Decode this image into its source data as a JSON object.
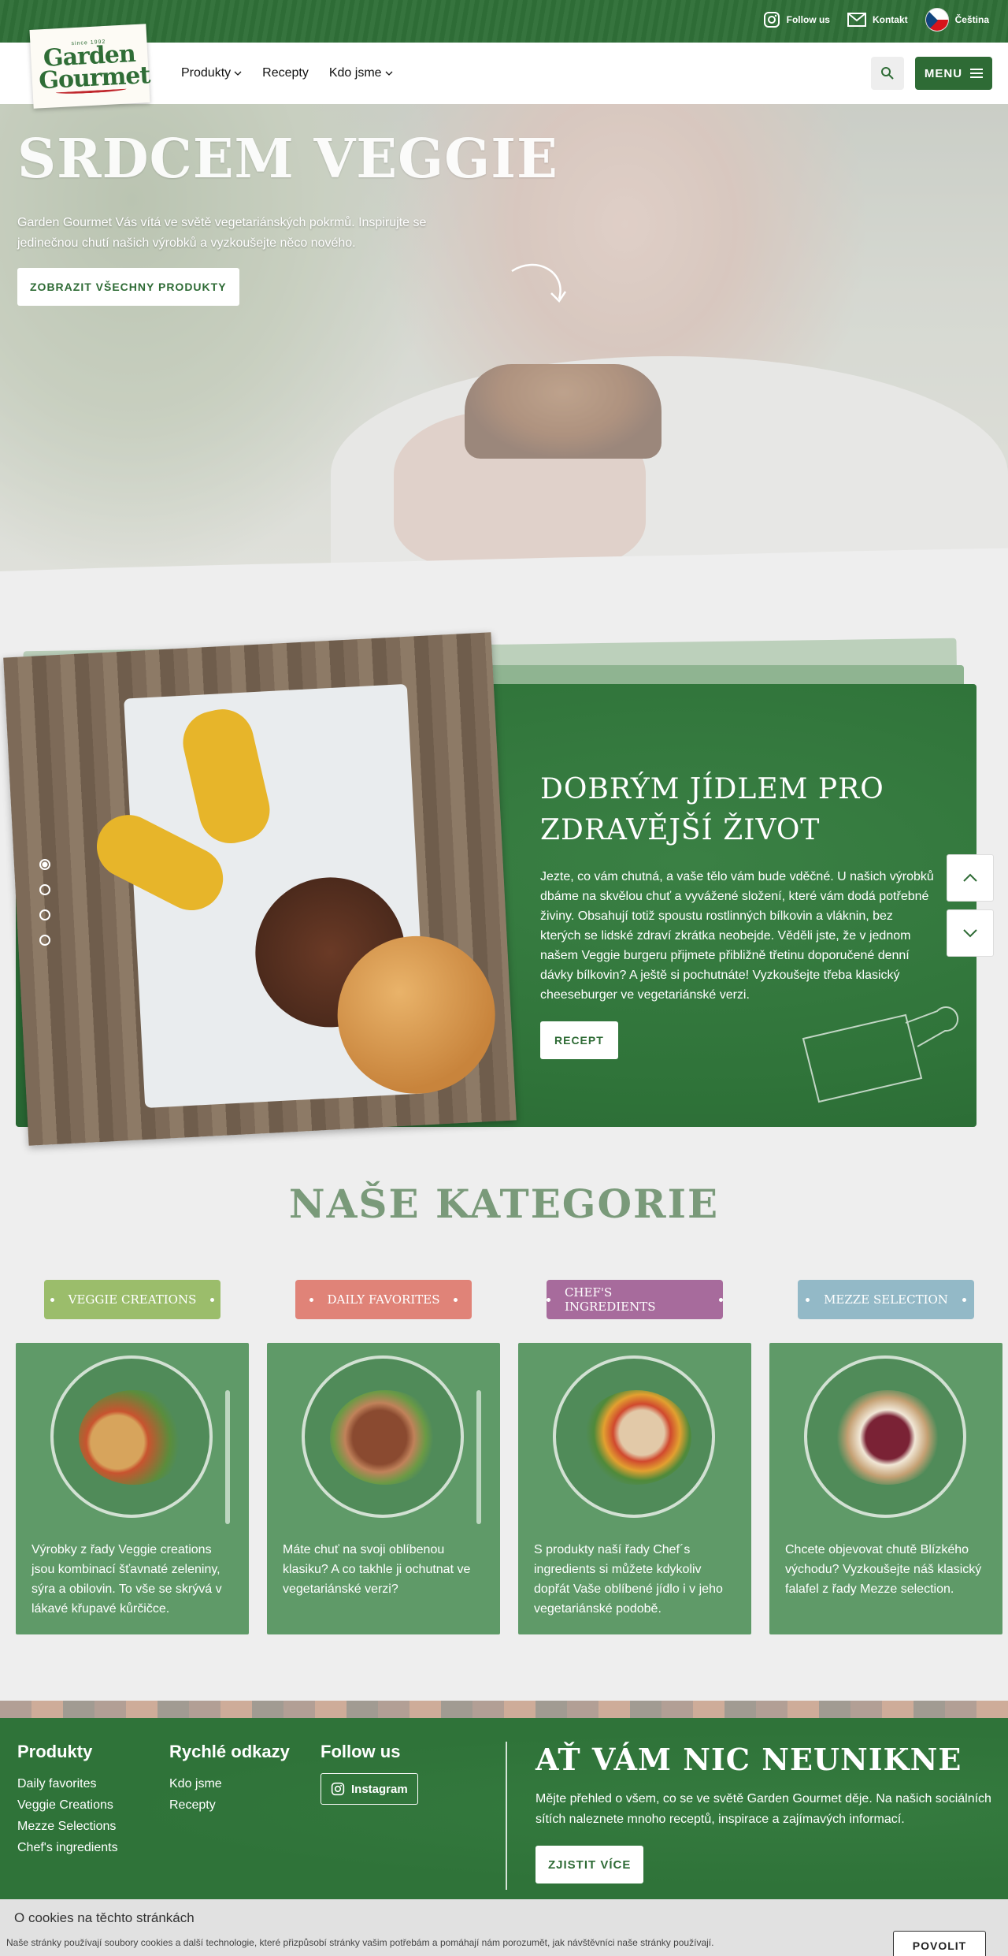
{
  "topbar": {
    "follow_us": "Follow us",
    "contact": "Kontakt",
    "language": "Čeština"
  },
  "header": {
    "logo_since": "since 1992",
    "logo_line1": "Garden",
    "logo_line2": "Gourmet",
    "nav": [
      {
        "label": "Produkty",
        "dropdown": true
      },
      {
        "label": "Recepty",
        "dropdown": false
      },
      {
        "label": "Kdo jsme",
        "dropdown": true
      }
    ],
    "menu_label": "MENU"
  },
  "hero": {
    "title": "SRDCEM VEGGIE",
    "subtitle": "Garden Gourmet Vás vítá ve světě vegetariánských pokrmů. Inspirujte se jedinečnou chutí našich výrobků a vyzkoušejte něco nového.",
    "cta": "ZOBRAZIT VŠECHNY PRODUKTY"
  },
  "slider": {
    "title": "DOBRÝM JÍDLEM PRO ZDRAVĚJŠÍ ŽIVOT",
    "text": "Jezte, co vám chutná, a vaše tělo vám bude vděčné. U našich výrobků dbáme na skvělou chuť a vyvážené složení, které vám dodá potřebné živiny. Obsahují totiž spoustu rostlinných bílkovin a vláknin, bez kterých se lidské zdraví zkrátka neobejde. Věděli jste, že v jednom našem Veggie burgeru přijmete přibližně třetinu doporučené denní dávky bílkovin? A ještě si pochutnáte! Vyzkoušejte třeba klasický cheeseburger ve vegetariánské verzi.",
    "button": "RECEPT",
    "slide_count": 4,
    "active_slide": 1
  },
  "categories": {
    "title": "NAŠE KATEGORIE",
    "items": [
      {
        "label": "VEGGIE CREATIONS",
        "color": "#9bbd6b",
        "desc": "Výrobky z řady Veggie creations jsou kombinací šťavnaté zeleniny, sýra a obilovin. To vše se skrývá v lákavé křupavé kůrčičce."
      },
      {
        "label": "DAILY FAVORITES",
        "color": "#e08378",
        "desc": "Máte chuť na svoji oblíbenou klasiku? A co takhle ji ochutnat ve vegetariánské verzi?"
      },
      {
        "label": "CHEF'S INGREDIENTS",
        "color": "#a76b9c",
        "desc": "S produkty naší řady Chef´s ingredients si můžete kdykoliv dopřát Vaše oblíbené jídlo i v jeho vegetariánské podobě."
      },
      {
        "label": "MEZZE SELECTION",
        "color": "#93b9c7",
        "desc": "Chcete objevovat chutě Blízkého východu? Vyzkoušejte náš klasický falafel z řady Mezze selection."
      }
    ]
  },
  "footer": {
    "products_title": "Produkty",
    "products": [
      "Daily favorites",
      "Veggie Creations",
      "Mezze Selections",
      "Chef's ingredients"
    ],
    "quick_title": "Rychlé odkazy",
    "quick": [
      "Kdo jsme",
      "Recepty"
    ],
    "follow_title": "Follow us",
    "instagram": "Instagram",
    "promo_title": "AŤ VÁM NIC NEUNIKNE",
    "promo_text": "Mějte přehled o všem, co se ve světě Garden Gourmet děje. Na našich sociálních sítích naleznete mnoho receptů, inspirace a zajímavých informací.",
    "promo_button": "ZJISTIT VÍCE"
  },
  "cookie": {
    "title": "O cookies na těchto stránkách",
    "text": "Naše stránky používají soubory cookies a další technologie, které přizpůsobí stránky vašim potřebám a pomáhají nám porozumět, jak návštěvníci naše stránky používají.",
    "button": "POVOLIT"
  }
}
